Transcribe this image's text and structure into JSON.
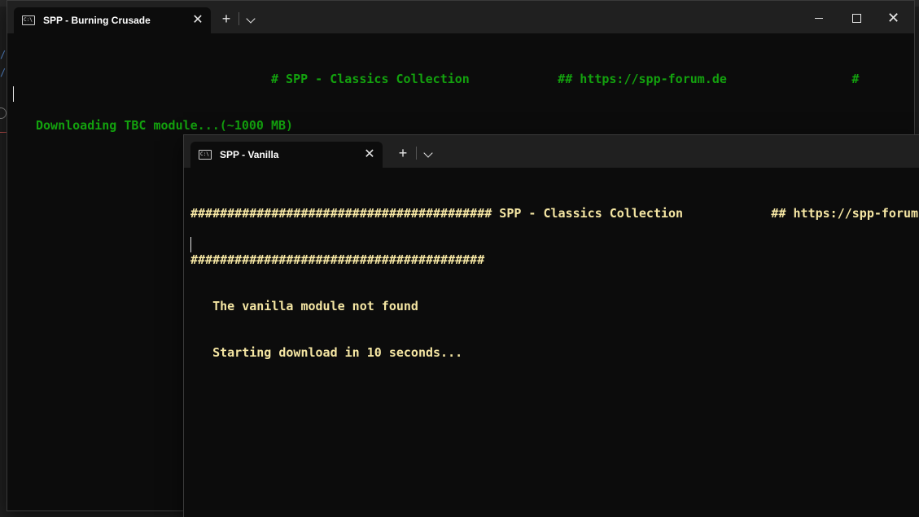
{
  "background": {
    "left_glyphs": [
      "/",
      "/"
    ]
  },
  "window_tbc": {
    "tab_title": "SPP - Burning Crusade",
    "close_tab": "✕",
    "new_tab": "+",
    "minimize_label": "",
    "maximize_label": "",
    "close_label": "✕",
    "console_lines": [
      "                                # SPP - Classics Collection            ## https://spp-forum.de                 #",
      "Downloading TBC module...(~1000 MB)"
    ],
    "text_color": "#13a10e"
  },
  "window_vanilla": {
    "tab_title": "SPP - Vanilla",
    "close_tab": "✕",
    "new_tab": "+",
    "console_lines": [
      "######################################### SPP - Classics Collection            ## https://spp-forum.de",
      "########################################",
      "   The vanilla module not found",
      "   Starting download in 10 seconds..."
    ],
    "text_color": "#f5e6a3"
  },
  "colors": {
    "console_bg": "#0c0c0c",
    "titlebar_bg": "#202020"
  }
}
